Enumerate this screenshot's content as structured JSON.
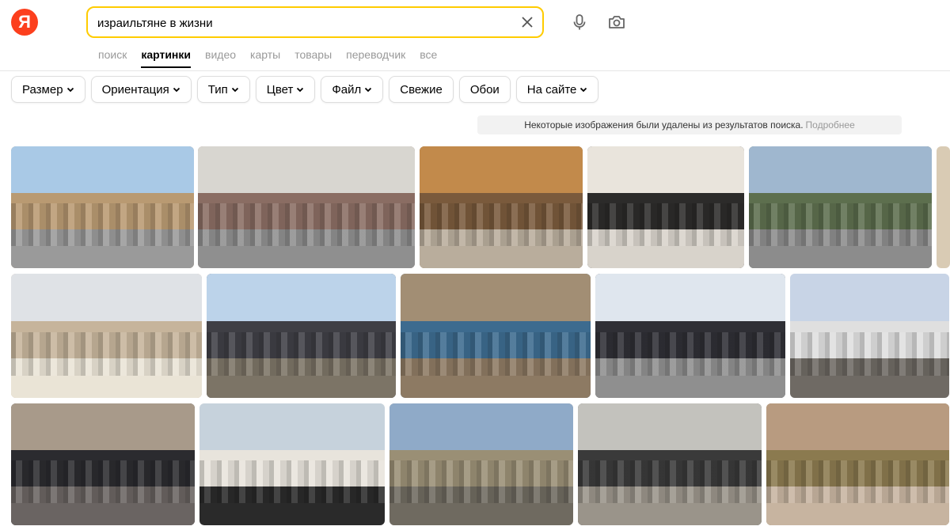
{
  "logo": {
    "letter": "Я",
    "color": "#fc3f1d"
  },
  "search": {
    "value": "израильтяне в жизни",
    "accent": "#ffcc00"
  },
  "icons": {
    "clear": "close-icon",
    "voice": "microphone-icon",
    "camera": "camera-search-icon"
  },
  "tabs": [
    {
      "label": "поиск",
      "active": false
    },
    {
      "label": "картинки",
      "active": true
    },
    {
      "label": "видео",
      "active": false
    },
    {
      "label": "карты",
      "active": false
    },
    {
      "label": "товары",
      "active": false
    },
    {
      "label": "переводчик",
      "active": false
    },
    {
      "label": "все",
      "active": false
    }
  ],
  "filters": [
    {
      "label": "Размер",
      "dropdown": true
    },
    {
      "label": "Ориентация",
      "dropdown": true
    },
    {
      "label": "Тип",
      "dropdown": true
    },
    {
      "label": "Цвет",
      "dropdown": true
    },
    {
      "label": "Файл",
      "dropdown": true
    },
    {
      "label": "Свежие",
      "dropdown": false
    },
    {
      "label": "Обои",
      "dropdown": false
    },
    {
      "label": "На сайте",
      "dropdown": true
    }
  ],
  "notice": {
    "text": "Некоторые изображения были удалены из результатов поиска.",
    "link": "Подробнее"
  },
  "images": [
    {
      "sky": "#a9c9e6",
      "mid": "#b99a72",
      "ground": "#9a9a9a"
    },
    {
      "sky": "#d8d6d0",
      "mid": "#8a6d63",
      "ground": "#8f8f8f"
    },
    {
      "sky": "#c28a4b",
      "mid": "#7a5a3c",
      "ground": "#b9ad9c"
    },
    {
      "sky": "#e9e4dc",
      "mid": "#2c2b2a",
      "ground": "#d8d3cb"
    },
    {
      "sky": "#9fb7cf",
      "mid": "#5d6f4e",
      "ground": "#8c8c8c"
    },
    {
      "sky": "#dfe2e6",
      "mid": "#c6b49b",
      "ground": "#eae4d6"
    },
    {
      "sky": "#bcd3ea",
      "mid": "#3f3f45",
      "ground": "#7c7466"
    },
    {
      "sky": "#a28e74",
      "mid": "#3d6b8f",
      "ground": "#8d7a63"
    },
    {
      "sky": "#dfe6ee",
      "mid": "#2f2f35",
      "ground": "#8f8f8f"
    },
    {
      "sky": "#c8d4e6",
      "mid": "#dfdfdf",
      "ground": "#6f6a64"
    },
    {
      "sky": "#a89a8a",
      "mid": "#2b2b2f",
      "ground": "#6a6462"
    },
    {
      "sky": "#c6d2dc",
      "mid": "#e8e4dc",
      "ground": "#2a2a2a"
    },
    {
      "sky": "#8faac8",
      "mid": "#9a8f75",
      "ground": "#6f6a60"
    },
    {
      "sky": "#c3c2bd",
      "mid": "#3a3a3a",
      "ground": "#9a948a"
    },
    {
      "sky": "#b89b80",
      "mid": "#8b7a4f",
      "ground": "#c7b4a0"
    }
  ]
}
